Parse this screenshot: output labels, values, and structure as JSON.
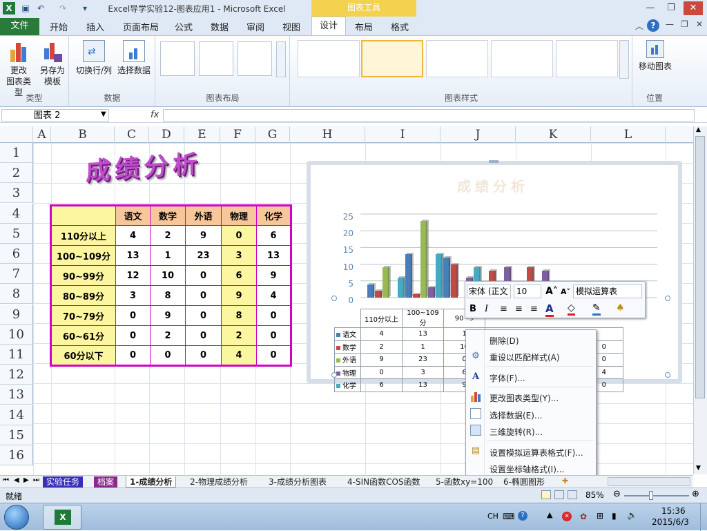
{
  "window": {
    "title": "Excel导学实验12-图表应用1  -  Microsoft Excel",
    "context_tab": "图表工具"
  },
  "tabs": [
    "文件",
    "开始",
    "插入",
    "页面布局",
    "公式",
    "数据",
    "审阅",
    "视图",
    "设计",
    "布局",
    "格式"
  ],
  "ribbon": {
    "type_group": {
      "label": "类型",
      "btn1": "更改\n图表类型",
      "btn1a": "更改",
      "btn1b": "图表类型",
      "btn2a": "另存为",
      "btn2b": "模板"
    },
    "data_group": {
      "label": "数据",
      "switch": "切换行/列",
      "select": "选择数据"
    },
    "layout_group": {
      "label": "图表布局"
    },
    "style_group": {
      "label": "图表样式"
    },
    "location_group": {
      "label": "位置",
      "move": "移动图表"
    }
  },
  "formula_bar": {
    "name_box": "图表 2",
    "fx": "fx",
    "value": ""
  },
  "columns": [
    "A",
    "B",
    "C",
    "D",
    "E",
    "F",
    "G",
    "H",
    "I",
    "J",
    "K",
    "L"
  ],
  "rows": [
    "1",
    "2",
    "3",
    "4",
    "5",
    "6",
    "7",
    "8",
    "9",
    "10",
    "11",
    "12",
    "13",
    "14",
    "15",
    "16"
  ],
  "sheet_title": "成绩分析",
  "table": {
    "headers": [
      "",
      "语文",
      "数学",
      "外语",
      "物理",
      "化学"
    ],
    "rows": [
      [
        "110分以上",
        "4",
        "2",
        "9",
        "0",
        "6"
      ],
      [
        "100~109分",
        "13",
        "1",
        "23",
        "3",
        "13"
      ],
      [
        "90~99分",
        "12",
        "10",
        "0",
        "6",
        "9"
      ],
      [
        "80~89分",
        "3",
        "8",
        "0",
        "9",
        "4"
      ],
      [
        "70~79分",
        "0",
        "9",
        "0",
        "8",
        "0"
      ],
      [
        "60~61分",
        "0",
        "2",
        "0",
        "2",
        "0"
      ],
      [
        "60分以下",
        "0",
        "0",
        "0",
        "4",
        "0"
      ]
    ]
  },
  "chart_data": {
    "type": "bar",
    "title": "成绩分析",
    "categories": [
      "110分以上",
      "100~109分",
      "90~99分",
      "80~89分",
      "70~79分",
      "60~61分",
      "60分以下"
    ],
    "series": [
      {
        "name": "语文",
        "values": [
          4,
          13,
          12,
          3,
          0,
          0,
          0
        ]
      },
      {
        "name": "数学",
        "values": [
          2,
          1,
          10,
          8,
          9,
          2,
          0
        ]
      },
      {
        "name": "外语",
        "values": [
          9,
          23,
          0,
          0,
          0,
          0,
          0
        ]
      },
      {
        "name": "物理",
        "values": [
          0,
          3,
          6,
          9,
          8,
          2,
          4
        ]
      },
      {
        "name": "化学",
        "values": [
          6,
          13,
          9,
          4,
          0,
          0,
          0
        ]
      }
    ],
    "ylim": [
      0,
      25
    ],
    "yticks": [
      "25",
      "20",
      "15",
      "10",
      "5",
      "0"
    ],
    "visible_categories": [
      "110分以上",
      "100~109分",
      "90~9"
    ],
    "data_table": [
      [
        "语文",
        "4",
        "13",
        "1"
      ],
      [
        "数学",
        "2",
        "1",
        "10"
      ],
      [
        "外语",
        "9",
        "23",
        "0"
      ],
      [
        "物理",
        "0",
        "3",
        "6"
      ],
      [
        "化学",
        "6",
        "13",
        "9"
      ]
    ],
    "data_table_tail": [
      "",
      "",
      "0",
      "0",
      "4",
      "0"
    ],
    "colors": [
      "#4a7ebb",
      "#be4b48",
      "#98b954",
      "#7d60a0",
      "#46aac5"
    ]
  },
  "mini_toolbar": {
    "font": "宋体 (正文",
    "size": "10",
    "element": "模拟运算表",
    "bold": "B",
    "italic": "I"
  },
  "context_menu": [
    {
      "label": "删除(D)",
      "icon": "none"
    },
    {
      "label": "重设以匹配样式(A)",
      "icon": "reset-style-icon"
    },
    {
      "label": "字体(F)...",
      "icon": "font-icon"
    },
    {
      "label": "更改图表类型(Y)...",
      "icon": "chart-type-icon"
    },
    {
      "label": "选择数据(E)...",
      "icon": "select-data-icon"
    },
    {
      "label": "三维旋转(R)...",
      "icon": "rotation-icon"
    },
    {
      "label": "设置模拟运算表格式(F)...",
      "icon": "format-table-icon"
    },
    {
      "label": "设置坐标轴格式(I)...",
      "icon": "none"
    }
  ],
  "sheet_tabs": [
    "实验任务",
    "档案",
    "1-成绩分析",
    "2-物理成绩分析",
    "3-成绩分析图表",
    "4-SIN函数COS函数",
    "5-函数xy=100",
    "6-椭圆图形"
  ],
  "status": {
    "ready": "就绪",
    "zoom": "85%"
  },
  "taskbar": {
    "lang": "CH",
    "time": "15:36",
    "date": "2015/6/3"
  }
}
